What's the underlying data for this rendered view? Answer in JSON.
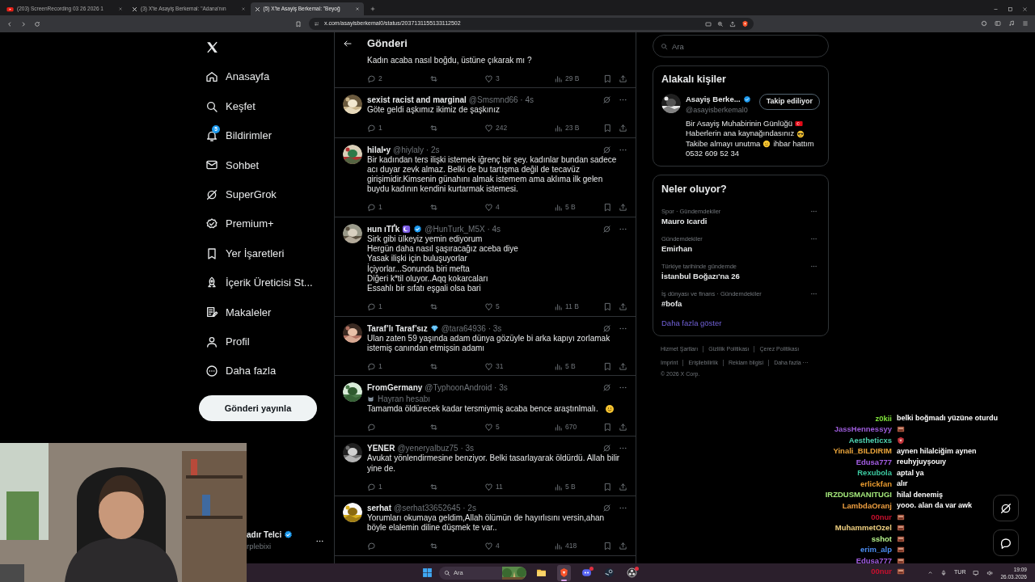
{
  "browser": {
    "tabs": [
      {
        "title": "(203) ScreenRecording 03 26 2026 1",
        "kind": "video",
        "selected": false
      },
      {
        "title": "(3) X'te Asayiş Berkemal: \"Adana'nın",
        "kind": "x",
        "selected": false
      },
      {
        "title": "(5) X'te Asayiş Berkemal: \"Beyoğ",
        "kind": "x",
        "selected": true
      }
    ],
    "url": "x.com/asayisberkemal0/status/2037131155133112502"
  },
  "nav": {
    "items": [
      {
        "label": "Anasayfa"
      },
      {
        "label": "Keşfet"
      },
      {
        "label": "Bildirimler",
        "badge": "5"
      },
      {
        "label": "Sohbet"
      },
      {
        "label": "SuperGrok"
      },
      {
        "label": "Premium+"
      },
      {
        "label": "Yer İşaretleri"
      },
      {
        "label": "İçerik Üreticisi St..."
      },
      {
        "label": "Makaleler"
      },
      {
        "label": "Profil"
      },
      {
        "label": "Daha fazla"
      }
    ],
    "post_button": "Gönderi yayınla",
    "account": {
      "name": "adır Telci",
      "handle": "rplebixi",
      "verified": true
    }
  },
  "thread": {
    "title": "Gönderi",
    "tweets": [
      {
        "text": "Kadın acaba nasıl boğdu, üstüne çıkarak mı ?",
        "replies": "2",
        "likes": "3",
        "views": "29 B"
      },
      {
        "name": "sexist racist and marginal",
        "verified": false,
        "meta": "@Smsmnd66 · 4s",
        "text": "Göte geldi aşkımız ikimiz de şaşkınız",
        "replies": "1",
        "likes": "242",
        "views": "23 B"
      },
      {
        "name": "hilal•y",
        "verified": false,
        "meta": "@hiylaly · 2s",
        "text": "Bir kadından ters ilişki istemek iğrenç bir şey. kadınlar bundan sadece acı duyar zevk almaz. Belki de bu tartışma değil de tecavüz girişimidir.Kimsenin günahını almak istemem ama aklıma ilk gelen buydu kadının kendini kurtarmak istemesi.",
        "replies": "1",
        "likes": "4",
        "views": "5 B"
      },
      {
        "name": "нun ıТҐk",
        "verified": true,
        "meta": "@HunTurk_M5X · 4s",
        "text": "Sirk gibi ülkeyiz yemin ediyorum\nHergün daha nasıl şaşıracağız aceba diye\nYasak ilişki için buluşuyorlar\nİçiyorlar...Sonunda biri mefta\nDiğeri k*til oluyor..Aqq kokarcaları\nEssahlı bir sıfatı eşgali olsa bari",
        "replies": "1",
        "likes": "5",
        "views": "11 B"
      },
      {
        "name": "Taraf’lı Taraf’sız",
        "verified": false,
        "meta": "@tara64936 · 3s",
        "text": "Ulan zaten 59 yaşında adam dünya gözüyle bi arka kapıyı zorlamak istemiş canından etmişsin adamı",
        "replies": "1",
        "likes": "31",
        "views": "5 B"
      },
      {
        "name": "FromGermany",
        "verified": false,
        "meta": "@TyphoonAndroid · 3s",
        "label": "Hayran hesabı",
        "text": "Tamamda öldürecek kadar tersmiymiş acaba bence araştınlmalı.",
        "likes": "5",
        "views": "670"
      },
      {
        "name": "YENER",
        "verified": false,
        "meta": "@yeneryalbuz75 · 3s",
        "text": "Avukat yönlendirmesine benziyor. Belki tasarlayarak öldürdü. Allah bilir yine de.",
        "replies": "1",
        "likes": "11",
        "views": "5 B"
      },
      {
        "name": "serhat",
        "verified": false,
        "meta": "@serhat33652645 · 2s",
        "text": "Yorumları okumaya geldim,Allah ölümün de hayırlısını versin,ahan böyle elalemin diline düşmek te var..",
        "likes": "4",
        "views": "418"
      }
    ]
  },
  "sidebar": {
    "search": {
      "placeholder": "Ara"
    },
    "related": {
      "title": "Alakalı kişiler",
      "person": {
        "name": "Asayiş Berke...",
        "verified": true,
        "handle": "@asayisberkemal0",
        "button": "Takip ediliyor",
        "bio": [
          {
            "text": "Bir Asayiş Muhabirinin Günlüğü"
          },
          {
            "text": "Haberlerin ana kaynağındasınız"
          },
          {
            "text": "Takibe almayı unutma",
            "after": "ihbar hattım"
          },
          {
            "text": "0532 609 52 34"
          }
        ]
      }
    },
    "trends": {
      "title": "Neler oluyor?",
      "items": [
        {
          "category": "Spor · Gündemdekiler",
          "title": "Mauro Icardi"
        },
        {
          "category": "Gündemdekiler",
          "title": "Emirhan"
        },
        {
          "category": "Türkiye tarihinde gündemde",
          "title": "İstanbul Boğazı'na 26"
        },
        {
          "category": "İş dünyası ve finans · Gündemdekiler",
          "title": "#bofa"
        }
      ],
      "more": "Daha fazla göster"
    },
    "footer": [
      "Hizmet Şartları",
      "Gizlilik Politikası",
      "Çerez Politikası",
      "Imprint",
      "Erişilebilirlik",
      "Reklam bilgisi",
      "Daha fazla ···"
    ],
    "copyright": "© 2026 X Corp."
  },
  "chat": [
    {
      "user": "z0kii",
      "color": "#7ee03a",
      "kind": "text",
      "message": "belki boğmadı yüzüne oturdu"
    },
    {
      "user": "JassHennessyy",
      "color": "#9b5bd8",
      "kind": "emote"
    },
    {
      "user": "Aestheticxs",
      "color": "#4fd1b0",
      "kind": "emote"
    },
    {
      "user": "Yinali_BILDIRIM",
      "color": "#e8a33a",
      "kind": "text",
      "message": "aynen hilalciğim aynen"
    },
    {
      "user": "Edusa777",
      "color": "#a45ee5",
      "kind": "text",
      "message": "reuhyjuyşouıy"
    },
    {
      "user": "Rexubola",
      "color": "#3cc9a0",
      "kind": "text",
      "message": "aptal ya"
    },
    {
      "user": "erlickfan",
      "color": "#e89a2e",
      "kind": "text",
      "message": "alır"
    },
    {
      "user": "IRZDUSMANITUGI",
      "color": "#a3e67a",
      "kind": "text",
      "message": "hilal denemiş"
    },
    {
      "user": "LambdaOranj",
      "color": "#f0a040",
      "kind": "text",
      "message": "yooo. alan da var awk"
    },
    {
      "user": "00nur",
      "color": "#c8102e",
      "kind": "emote"
    },
    {
      "user": "MuhammetOzel",
      "color": "#f0d080",
      "kind": "emote"
    },
    {
      "user": "sshot",
      "color": "#b5f08a",
      "kind": "emote"
    },
    {
      "user": "erim_alp",
      "color": "#4a8cf0",
      "kind": "emote"
    },
    {
      "user": "Edusa777",
      "color": "#a45ee5",
      "kind": "emote"
    },
    {
      "user": "00nur",
      "color": "#c8102e",
      "kind": "emote"
    }
  ],
  "taskbar": {
    "search": {
      "placeholder": "Ara"
    },
    "apps": [
      {
        "kind": "folder",
        "selected": false,
        "badge": false
      },
      {
        "kind": "browser",
        "selected": true,
        "badge": false
      },
      {
        "kind": "discord",
        "selected": false,
        "badge": true
      },
      {
        "kind": "steam",
        "selected": false,
        "badge": false
      },
      {
        "kind": "obs",
        "selected": false,
        "badge": true
      }
    ],
    "language": "TUR",
    "time": "19:09",
    "date": "26.03.2026"
  }
}
